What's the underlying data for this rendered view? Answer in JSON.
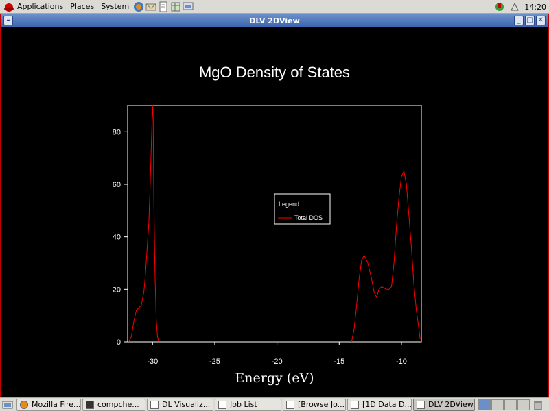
{
  "top_panel": {
    "menus": [
      "Applications",
      "Places",
      "System"
    ],
    "clock": "14:20"
  },
  "window": {
    "title": "DLV 2DView"
  },
  "chart_data": {
    "type": "line",
    "title": "MgO Density of States",
    "xlabel": "Energy (eV)",
    "ylabel": "",
    "xlim": [
      -32,
      -8.4
    ],
    "ylim": [
      0,
      90
    ],
    "xticks": [
      -30,
      -25,
      -20,
      -15,
      -10
    ],
    "xtick_labels": [
      "-30",
      "-25",
      "-20",
      "-15",
      "-10"
    ],
    "yticks": [
      0,
      20,
      40,
      60,
      80
    ],
    "ytick_labels": [
      "0",
      "20",
      "40",
      "60",
      "80"
    ],
    "legend": {
      "title": "Legend",
      "placement": "center"
    },
    "series": [
      {
        "name": "Total DOS",
        "color": "#ff0000",
        "segments": [
          {
            "x": [
              -31.9,
              -31.7,
              -31.5,
              -31.3,
              -31.1,
              -30.9,
              -30.7,
              -30.6,
              -30.5,
              -30.4,
              -30.3,
              -30.2,
              -30.1,
              -30.0,
              -29.95,
              -29.9,
              -29.8,
              -29.7,
              -29.6,
              -29.5
            ],
            "y": [
              0,
              2,
              8,
              12,
              13,
              14,
              19,
              24,
              31,
              38,
              45,
              58,
              75,
              90,
              85,
              55,
              25,
              8,
              2,
              0
            ]
          },
          {
            "x": [
              -14.0,
              -13.8,
              -13.6,
              -13.4,
              -13.2,
              -13.0,
              -12.7,
              -12.4,
              -12.2,
              -12.0,
              -11.8,
              -11.6,
              -11.4,
              -11.2,
              -11.0,
              -10.8,
              -10.6,
              -10.4,
              -10.2,
              -10.0,
              -9.8,
              -9.6,
              -9.4,
              -9.2,
              -9.0,
              -8.8,
              -8.6,
              -8.5
            ],
            "y": [
              0,
              5,
              14,
              24,
              31,
              33,
              30,
              24,
              19,
              17,
              20,
              21,
              20.5,
              20,
              20,
              21,
              30,
              44,
              55,
              63,
              65,
              60,
              48,
              36,
              22,
              12,
              5,
              1
            ]
          }
        ]
      }
    ]
  },
  "taskbar": {
    "items": [
      {
        "label": "Mozilla Fire...",
        "icon": "firefox-icon",
        "active": false
      },
      {
        "label": "compche...",
        "icon": "terminal-icon",
        "active": false
      },
      {
        "label": "DL Visualiz...",
        "icon": "window-icon",
        "active": false
      },
      {
        "label": "Job List",
        "icon": "window-icon",
        "active": false
      },
      {
        "label": "[Browse Jo...",
        "icon": "window-icon",
        "active": false
      },
      {
        "label": "[1D Data D...",
        "icon": "window-icon",
        "active": false
      },
      {
        "label": "DLV 2DView",
        "icon": "window-icon",
        "active": true
      }
    ]
  }
}
